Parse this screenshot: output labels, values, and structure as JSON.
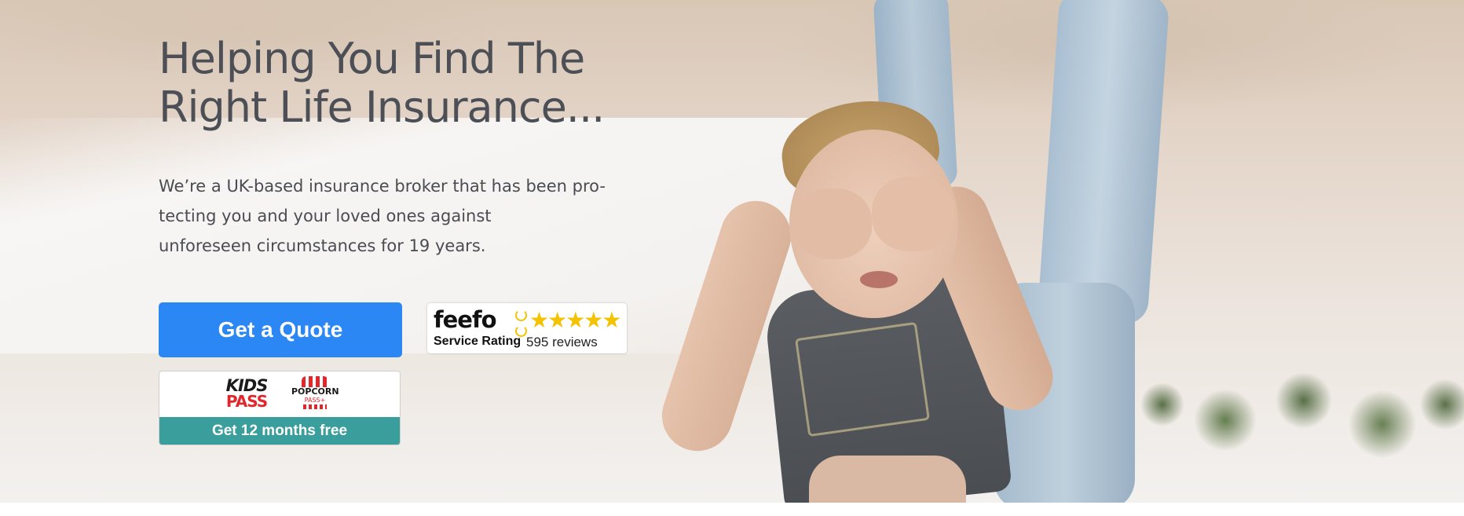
{
  "hero": {
    "headline_line1": "Helping You Find The",
    "headline_line2": "Right Life Insurance...",
    "lead_line1": "We’re a UK-based insurance broker that has been pro-",
    "lead_line2": "tecting you and your loved ones against",
    "lead_line3": "unforeseen circumstances for 19 years."
  },
  "cta": {
    "quote_label": "Get a Quote",
    "accent_color": "#2b87f4"
  },
  "feefo": {
    "logo_text": "feefo",
    "service_label": "Service Rating",
    "stars": "★★★★★",
    "rating_stars": 5,
    "reviews_label": "595 reviews",
    "star_color": "#f5c200"
  },
  "kids_pass": {
    "logo_line1": "KIDS",
    "logo_line2": "PASS",
    "popcorn_line1": "POPCORN",
    "popcorn_line2": "PASS+",
    "offer_label": "Get 12 months free",
    "banner_color": "#3a9e9c"
  }
}
